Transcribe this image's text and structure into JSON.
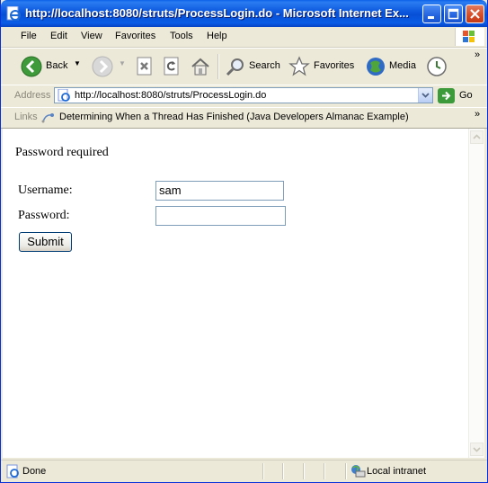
{
  "window": {
    "title": "http://localhost:8080/struts/ProcessLogin.do - Microsoft Internet Ex...",
    "accent": "#0A5CE6"
  },
  "menu": {
    "file": "File",
    "edit": "Edit",
    "view": "View",
    "favorites": "Favorites",
    "tools": "Tools",
    "help": "Help"
  },
  "toolbar": {
    "back": "Back",
    "search": "Search",
    "favorites": "Favorites",
    "media": "Media"
  },
  "address": {
    "label": "Address",
    "url": "http://localhost:8080/struts/ProcessLogin.do",
    "go": "Go"
  },
  "links": {
    "label": "Links",
    "item": "Determining When a Thread Has Finished (Java Developers Almanac Example)"
  },
  "page": {
    "message": "Password required",
    "username_label": "Username:",
    "username_value": "sam",
    "password_label": "Password:",
    "password_value": "",
    "submit": "Submit"
  },
  "status": {
    "text": "Done",
    "zone": "Local intranet"
  }
}
